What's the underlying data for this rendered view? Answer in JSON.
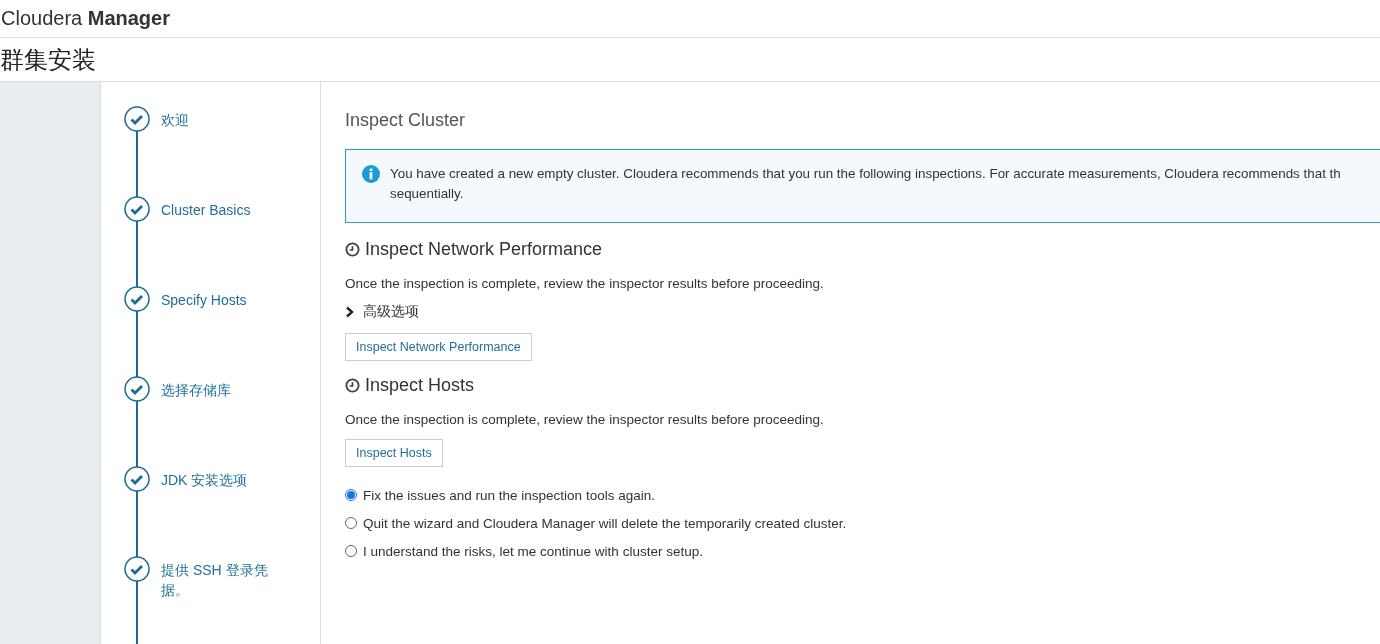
{
  "brand": {
    "light": "Cloudera",
    "bold": "Manager"
  },
  "page_title": "群集安装",
  "steps": [
    {
      "label": "欢迎",
      "done": true
    },
    {
      "label": "Cluster Basics",
      "done": true
    },
    {
      "label": "Specify Hosts",
      "done": true
    },
    {
      "label": "选择存储库",
      "done": true
    },
    {
      "label": "JDK 安装选项",
      "done": true
    },
    {
      "label": "提供 SSH 登录凭据。",
      "done": true
    }
  ],
  "main": {
    "title": "Inspect Cluster",
    "info_lines": [
      "You have created a new empty cluster. Cloudera recommends that you run the following inspections. For accurate measurements, Cloudera recommends that th",
      "sequentially."
    ],
    "sections": [
      {
        "heading": "Inspect Network Performance",
        "note": "Once the inspection is complete, review the inspector results before proceeding.",
        "advanced": {
          "label": "高级选项",
          "expanded": false
        },
        "button": "Inspect Network Performance"
      },
      {
        "heading": "Inspect Hosts",
        "note": "Once the inspection is complete, review the inspector results before proceeding.",
        "button": "Inspect Hosts"
      }
    ],
    "options": [
      {
        "label": "Fix the issues and run the inspection tools again.",
        "selected": true
      },
      {
        "label": "Quit the wizard and Cloudera Manager will delete the temporarily created cluster.",
        "selected": false
      },
      {
        "label": "I understand the risks, let me continue with cluster setup.",
        "selected": false
      }
    ]
  }
}
